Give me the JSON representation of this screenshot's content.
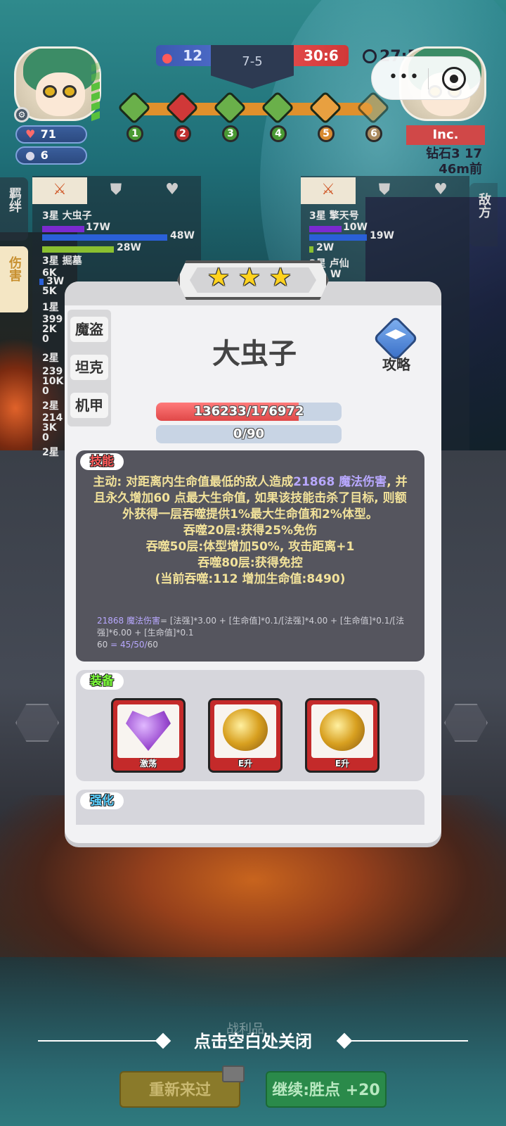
{
  "hud": {
    "player": {
      "hp": "71",
      "coins": "6"
    },
    "score": {
      "left": "12",
      "round": "7-5",
      "right": "30:6",
      "timer": "27:5"
    },
    "stages": [
      "1",
      "2",
      "3",
      "4",
      "5",
      "6"
    ],
    "opponent": {
      "name": "Inc.",
      "rank": "钻石3 17",
      "time_ago": "46m前"
    },
    "system": {
      "menu_dots": "•••"
    }
  },
  "side_tabs": {
    "bond": "羁绊",
    "damage": "伤害",
    "enemy": "敌方"
  },
  "left_panel": {
    "rows": [
      {
        "name": "3星 大虫子",
        "v1": "17W",
        "v2": "48W",
        "v3": "28W"
      },
      {
        "name": "3星 掘墓",
        "v1": "6K",
        "v2": "3W",
        "v3": "5K"
      },
      {
        "name": "1星",
        "v1": "399",
        "v2": "2K",
        "v3": "0"
      },
      {
        "name": "2星",
        "v1": "239",
        "v2": "10K",
        "v3": "0"
      },
      {
        "name": "2星",
        "v1": "214",
        "v2": "3K",
        "v3": "0"
      },
      {
        "name": "2星"
      }
    ]
  },
  "right_panel": {
    "rows": [
      {
        "name": "3星 擎天号",
        "v1": "10W",
        "v2": "19W",
        "v3": "2W"
      },
      {
        "name": "2星 卢仙",
        "v1": "W"
      }
    ]
  },
  "hero": {
    "stars": 3,
    "name": "大虫子",
    "traits": [
      "魔盗",
      "坦克",
      "机甲"
    ],
    "guide_label": "攻略",
    "hp_text": "136233/176972",
    "hp_current": 136233,
    "hp_max": 176972,
    "mana_text": "0/90",
    "mana_current": 0,
    "mana_max": 90
  },
  "skill": {
    "label": "技能",
    "line1_a": "主动: 对距离内生命值最低的敌人造成",
    "line1_hl": "21868 魔法伤害",
    "line1_b": ", 并且永久增加60 点最大生命值, 如果该技能击杀了目标, 则额外获得一层吞噬提供1%最大生命值和2%体型。",
    "line2": "吞噬20层:获得25%免伤",
    "line3": "吞噬50层:体型增加50%, 攻击距离+1",
    "line4": "吞噬80层:获得免控",
    "line5": "(当前吞噬:112 增加生命值:8490)",
    "formula_hl": "21868 魔法伤害",
    "formula_rest": "= [法强]*3.00 + [生命值]*0.1/[法强]*4.00 + [生命值]*0.1/[法强]*6.00 + [生命值]*0.1",
    "formula2_a": "60",
    "formula2_b": " = 45/50/",
    "formula2_c": "60"
  },
  "equipment": {
    "label": "装备",
    "items": [
      {
        "name": "激荡",
        "icon": "purple-heart-icon"
      },
      {
        "name": "E升",
        "icon": "golden-orb-icon"
      },
      {
        "name": "E升",
        "icon": "golden-orb-icon"
      }
    ]
  },
  "enhance": {
    "label": "强化"
  },
  "footer": {
    "close_hint": "点击空白处关闭",
    "spoils": "战利品",
    "retry_label": "重新来过",
    "continue_label": "继续:胜点 +20"
  },
  "colors": {
    "skill_label": "#ff5a5a",
    "equip_label": "#7cff3a",
    "enhance_label": "#5ad0ff",
    "hp_fill": "#e04848",
    "highlight": "#b8a8ff"
  }
}
